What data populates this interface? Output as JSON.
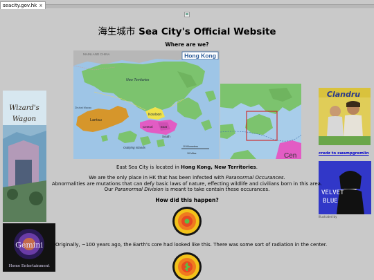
{
  "browser": {
    "tab_title": "seacity.gov.hk",
    "tab_close": "x"
  },
  "page": {
    "title_cjk": "海生城市",
    "title_en": "Sea City's Official Website",
    "section_where": "Where are we?",
    "section_how": "How did this happen?"
  },
  "map": {
    "hk_label": "Hong Kong",
    "region_labels": {
      "mainland": "MAINLAND CHINA",
      "new_territories": "New Territories",
      "kowloon": "Kowloon",
      "lantau": "Lantau",
      "central": "Central",
      "east": "East",
      "south": "South",
      "outlying": "Outlying Islands",
      "zhuhai": "Zhuhai Macau",
      "scale_km": "10 Kilometers",
      "scale_mi": "10 Miles"
    },
    "zoom_label": "Cen"
  },
  "content": {
    "location_prefix": "East Sea City is located in ",
    "location_bold": "Hong Kong, New Territories",
    "location_suffix": ".",
    "line1_prefix": "We are the only place in HK that has been infected with ",
    "line1_italic": "Paranormal Occurances",
    "line1_suffix": ".",
    "line2": "Abnormalities are mutations that can defy basic laws of nature, effecting wildlife and civilians born in this area.",
    "line3_prefix": "Our ",
    "line3_italic": "Paranormal Division",
    "line3_suffix": " is meant to take contain these occurances.",
    "core_caption": "Originally, ~100 years ago, the Earth's core had looked like this. There was some sort of radiation in the center."
  },
  "sidebar_left": {
    "wizard_title_1": "Wizard's",
    "wizard_title_2": "Wagon",
    "gemini_title": "Gemini",
    "gemini_sub": "Home Entertainment"
  },
  "sidebar_right": {
    "clandru_title": "Clandru",
    "credz_link": "credz to swampgremlin",
    "velvet_title_1": "VELVET",
    "velvet_title_2": "BLUE",
    "velvet_caption": "Illustrated by"
  },
  "colors": {
    "page_bg": "#c9c9c9",
    "land_green": "#7cc36e",
    "lantau_orange": "#d6962b",
    "urban_pink": "#e25cc4",
    "kowloon_yellow": "#f0e24a",
    "mainland_grey": "#b7b7b7",
    "water_blue": "#9ec5e6",
    "link_blue": "#0000cc"
  }
}
